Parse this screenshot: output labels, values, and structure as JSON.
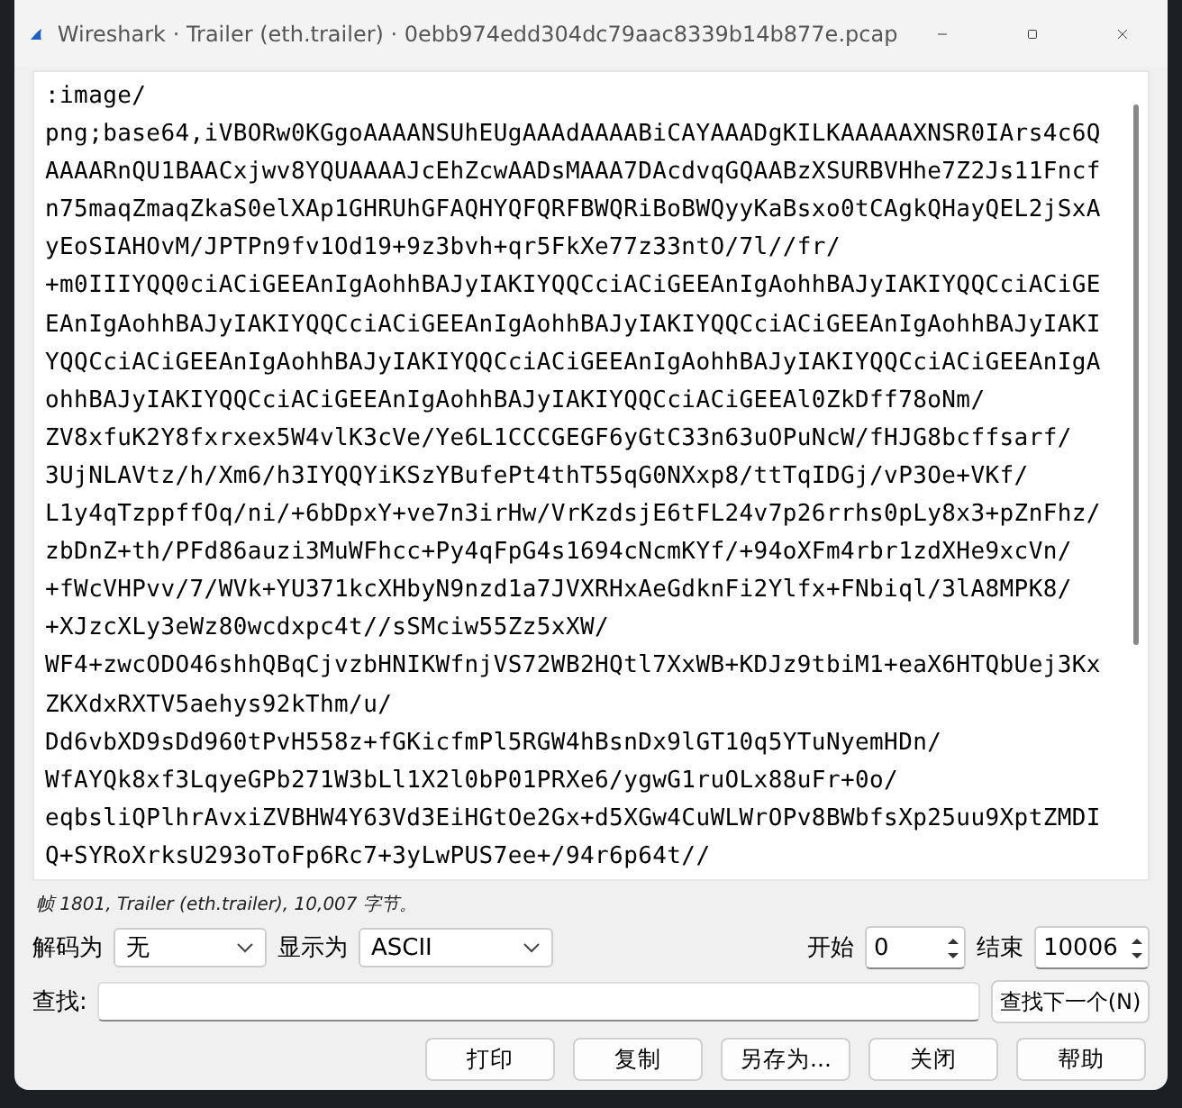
{
  "window": {
    "title": "Wireshark · Trailer (eth.trailer) · 0ebb974edd304dc79aac8339b14b877e.pcap"
  },
  "content_lines": [
    ":image/",
    "png;base64,iVBORw0KGgoAAAANSUhEUgAAAdAAAABiCAYAAADgKILKAAAAAXNSR0IArs4c6Q",
    "AAAARnQU1BAACxjwv8YQUAAAAJcEhZcwAADsMAAA7DAcdvqGQAABzXSURBVHhe7Z2Js11Fncf",
    "n75maqZmaqZkaS0elXAp1GHRUhGFAQHYQFQRFBWQRiBoBWQyyKaBsxo0tCAgkQHayQEL2jSxA",
    "yEoSIAHOvM/JPTPn9fv1Od19+9z3bvh+qr5FkXe77z33ntO/7l//fr/",
    "+m0IIIYQQ0ciACiGEEAnIgAohhBAJyIAKIYQQCciACiGEEAnIgAohhBAJyIAKIYQQCciACiGE",
    "EAnIgAohhBAJyIAKIYQQCciACiGEEAnIgAohhBAJyIAKIYQQCciACiGEEAnIgAohhBAJyIAKI",
    "YQQCciACiGEEAnIgAohhBAJyIAKIYQQCciACiGEEAnIgAohhBAJyIAKIYQQCciACiGEEAnIgA",
    "ohhBAJyIAKIYQQCciACiGEEAnIgAohhBAJyIAKIYQQCciACiGEEAl0ZkDff78oNm/",
    "ZV8xfuK2Y8fxrxex5W4vlK3cVe/Ye6L1CCCGEGF6yGtC33n63uOPuNcW/fHJG8bcffsarf/",
    "3UjNLAVtz/h/Xm6/h3IYQQYiKSzYBufePt4thT55qG0NXxp8/ttTqIDGj/vP3Oe+VKf/",
    "L1y4qTzppffOq/ni/+6bDpxY+ve7n3irHw/VrKzdsjE6tFL24v7p26rrhs0pLy8x3+pZnFhz/",
    "zbDnZ+th/PFd86auzi3MuWFhcc+Py4qFpG4s1694cNcmKYf/+94oXFm4rbr1zdXHe9xcVn/",
    "+fWcVHPvv/7/WVk+YU371kcXHbyN9nzd1a7JVXRHxAeGdknFi2Ylfx+FNbiql/3lA8MPK8/",
    "+XJzcXLy3eWz80wcdxpc4t//sSMciw55Zz5xXW/",
    "WF4+zwcODO46shhQBqCjvzbHNIKWfnjVS72WB2HQtl7XxWB+KDJz9tbiM1+eaX6HTQbUej3Kx",
    "ZKXdxRXTV5aehys92kThm/u/",
    "Dd6vbXD9sDd960tPvH558z+fGKicfmPl5RGW4hBsnDx9lGT10q5YTuNyemHDn/",
    "WfAYQk8xf3LqyeGPb271W3bLl1X2l0bP01PRXe6/ygwG1ruOLx88uFr+0o/",
    "eqbsliQPlhrAvxiZVBHW4Y63Vd3EiHGtOe2Gx+d5XGw4CuWLWrOPv8BWbfsXp25uu9XptZMDI",
    "Q+SYRoXrksU293oToFp6Rc7+3yLwPUS7ee+/94r6p64t//"
  ],
  "status": "帧 1801, Trailer (eth.trailer), 10,007 字节。",
  "decode": {
    "label": "解码为",
    "value": "无"
  },
  "show_as": {
    "label": "显示为",
    "value": "ASCII"
  },
  "start": {
    "label": "开始",
    "value": "0"
  },
  "end": {
    "label": "结束",
    "value": "10006"
  },
  "find": {
    "label": "查找:",
    "button": "查找下一个(N)"
  },
  "buttons": [
    "打印",
    "复制",
    "另存为...",
    "关闭",
    "帮助"
  ]
}
